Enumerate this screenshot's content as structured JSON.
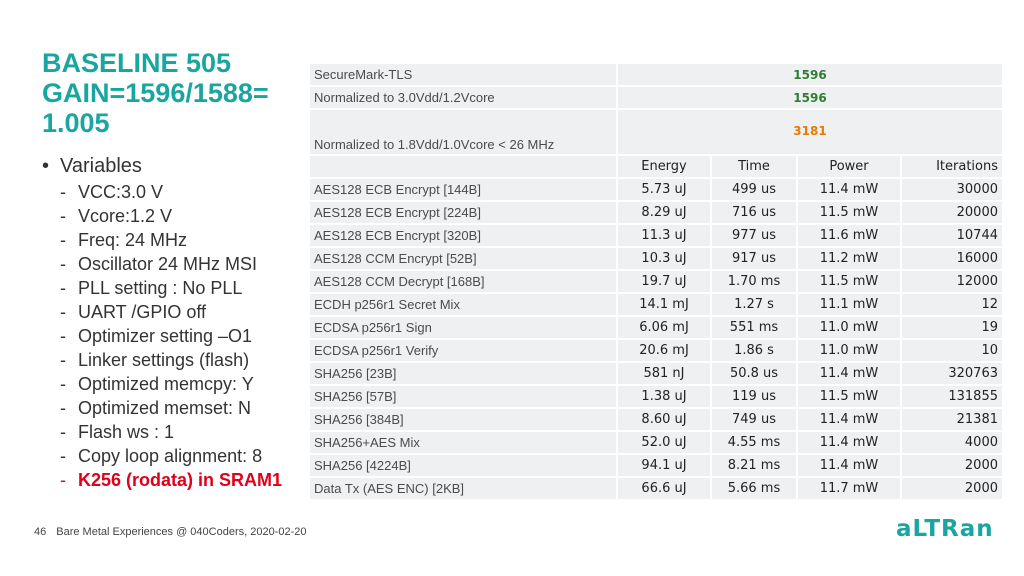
{
  "title": [
    "BASELINE 505",
    "GAIN=1596/1588=",
    "1.005"
  ],
  "bullet_label": "Variables",
  "settings": [
    "VCC:3.0 V",
    "Vcore:1.2 V",
    "Freq: 24 MHz",
    "Oscillator 24 MHz MSI",
    "PLL setting : No PLL",
    "UART /GPIO off",
    "Optimizer setting –O1",
    "Linker settings (flash)",
    "Optimized memcpy: Y",
    "Optimized memset: N",
    "Flash ws : 1",
    "Copy loop alignment: 8"
  ],
  "highlight_setting": "K256 (rodata) in SRAM1",
  "summary": {
    "securemark_label": "SecureMark-TLS",
    "securemark_value": "1596",
    "normalized_label": "Normalized to 3.0Vdd/1.2Vcore",
    "normalized_value": "1596",
    "normalized18_label": "Normalized to 1.8Vdd/1.0Vcore < 26 MHz",
    "normalized18_value": "3181"
  },
  "columns": [
    "Energy",
    "Time",
    "Power",
    "Iterations"
  ],
  "rows": [
    {
      "label": "AES128 ECB Encrypt [144B]",
      "energy": "5.73 uJ",
      "time": "499 us",
      "power": "11.4 mW",
      "iterations": "30000"
    },
    {
      "label": "AES128 ECB Encrypt [224B]",
      "energy": "8.29 uJ",
      "time": "716 us",
      "power": "11.5 mW",
      "iterations": "20000"
    },
    {
      "label": "AES128 ECB Encrypt [320B]",
      "energy": "11.3 uJ",
      "time": "977 us",
      "power": "11.6 mW",
      "iterations": "10744"
    },
    {
      "label": "AES128 CCM Encrypt [52B]",
      "energy": "10.3 uJ",
      "time": "917 us",
      "power": "11.2 mW",
      "iterations": "16000"
    },
    {
      "label": "AES128 CCM Decrypt [168B]",
      "energy": "19.7 uJ",
      "time": "1.70 ms",
      "power": "11.5 mW",
      "iterations": "12000"
    },
    {
      "label": "ECDH p256r1 Secret Mix",
      "energy": "14.1 mJ",
      "time": "1.27 s",
      "power": "11.1 mW",
      "iterations": "12"
    },
    {
      "label": "ECDSA p256r1 Sign",
      "energy": "6.06 mJ",
      "time": "551 ms",
      "power": "11.0 mW",
      "iterations": "19"
    },
    {
      "label": "ECDSA p256r1 Verify",
      "energy": "20.6 mJ",
      "time": "1.86 s",
      "power": "11.0 mW",
      "iterations": "10"
    },
    {
      "label": "SHA256 [23B]",
      "energy": "581 nJ",
      "time": "50.8 us",
      "power": "11.4 mW",
      "iterations": "320763"
    },
    {
      "label": "SHA256 [57B]",
      "energy": "1.38 uJ",
      "time": "119 us",
      "power": "11.5 mW",
      "iterations": "131855"
    },
    {
      "label": "SHA256 [384B]",
      "energy": "8.60 uJ",
      "time": "749 us",
      "power": "11.4 mW",
      "iterations": "21381"
    },
    {
      "label": "SHA256+AES Mix",
      "energy": "52.0 uJ",
      "time": "4.55 ms",
      "power": "11.4 mW",
      "iterations": "4000"
    },
    {
      "label": "SHA256 [4224B]",
      "energy": "94.1 uJ",
      "time": "8.21 ms",
      "power": "11.4 mW",
      "iterations": "2000"
    },
    {
      "label": "Data Tx (AES ENC) [2KB]",
      "energy": "66.6 uJ",
      "time": "5.66 ms",
      "power": "11.7 mW",
      "iterations": "2000"
    }
  ],
  "footer": {
    "page_number": "46",
    "text": "Bare Metal Experiences @ 040Coders, 2020-02-20"
  },
  "logo_text": "aLTRan",
  "colors": {
    "title": "#1aa6a0",
    "highlight": "#e0001b",
    "score_green": "#2e7d32",
    "score_orange": "#e87b00",
    "cell_bg": "#eef0f2",
    "logo": "#1aa6a0"
  }
}
